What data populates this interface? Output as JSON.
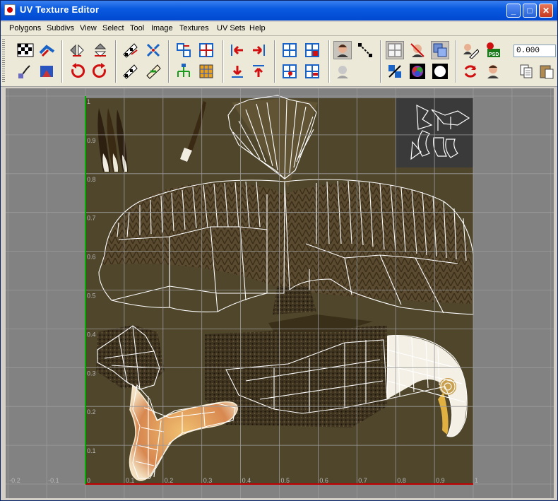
{
  "window": {
    "title": "UV Texture Editor"
  },
  "titlebar_buttons": {
    "minimize": "_",
    "maximize": "□",
    "close": "✕"
  },
  "menu": [
    "Polygons",
    "Subdivs",
    "View",
    "Select",
    "Tool",
    "Image",
    "Textures",
    "UV Sets",
    "Help"
  ],
  "toolbar": {
    "value": "0.000"
  },
  "axis": {
    "x_labels": [
      "-0.2",
      "-0.1",
      "0",
      "0.1",
      "0.2",
      "0.3",
      "0.4",
      "0.5",
      "0.6",
      "0.7",
      "0.8",
      "0.9",
      "1"
    ],
    "y_labels": [
      "1",
      "0.9",
      "0.8",
      "0.7",
      "0.6",
      "0.5",
      "0.4",
      "0.3",
      "0.2",
      "0.1"
    ]
  },
  "colors": {
    "texture_bg": "#4f462b",
    "wireframe": "#ffffff",
    "u_axis": "#c00000",
    "v_axis": "#00b000",
    "grid": "#9a9a9a",
    "viewport_bg": "#828282"
  }
}
